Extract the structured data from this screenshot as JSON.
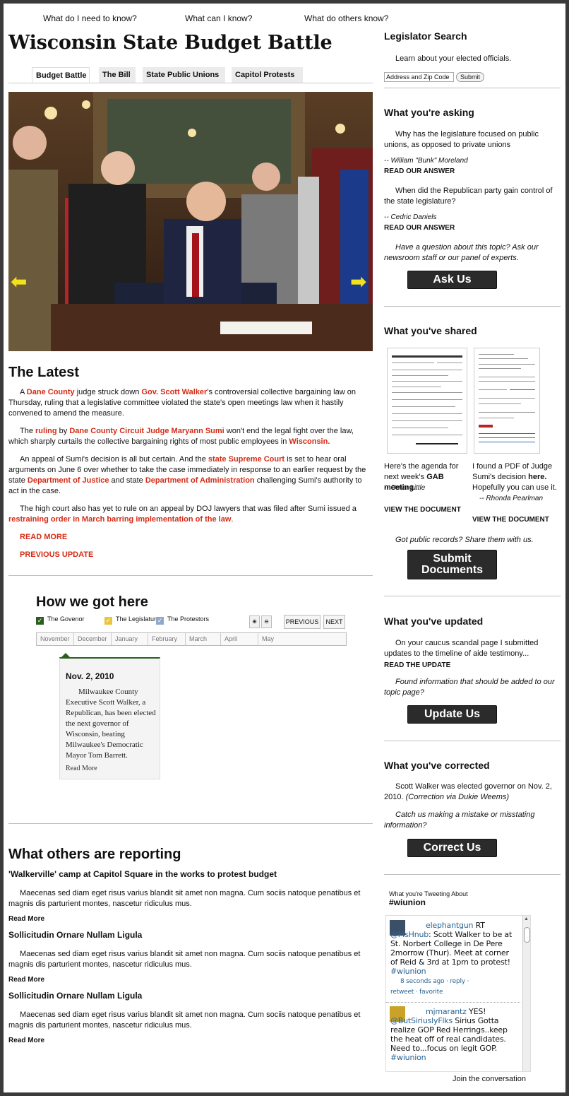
{
  "topnav": [
    "What do I need to know?",
    "What can I know?",
    "What do others know?"
  ],
  "site_title": "Wisconsin State Budget Battle",
  "tabs": [
    "Budget Battle",
    "The Bill",
    "State Public Unions",
    "Capitol Protests"
  ],
  "hero": {
    "prev_arrow": "⬅",
    "next_arrow": "➡"
  },
  "latest": {
    "heading": "The Latest",
    "p1": {
      "t1": "A ",
      "l1": "Dane County",
      "t2": " judge struck down ",
      "l2": "Gov. Scott Walker",
      "t3": "'s controversial collective bargaining law on Thursday, ruling that a legislative committee violated the state's open meetings law when it hastily convened to amend the measure."
    },
    "p2": {
      "t1": "The ",
      "l1": "ruling",
      "t2": " by ",
      "l2": "Dane County Circuit Judge Maryann Sumi",
      "t3": " won't end the legal fight over the law, which sharply curtails the collective bargaining rights of most public employees in ",
      "l3": "Wisconsin."
    },
    "p3": {
      "t1": "An appeal of Sumi's decision is all but certain. And the ",
      "l1": "state Supreme Court",
      "t2": " is set to hear oral arguments on June 6 over whether to take the case immediately in response to an earlier request by the state ",
      "l2": "Department of Justice",
      "t3": " and state ",
      "l3": "Department of Administration",
      "t4": " challenging Sumi's authority to act in the case."
    },
    "p4": {
      "t1": "The high court also has yet to rule on an appeal by DOJ lawyers that was filed after Sumi issued a ",
      "l1": "restraining order in March barring implementation of the law",
      "t2": "."
    },
    "read_more": "READ MORE",
    "previous_update": "PREVIOUS UPDATE"
  },
  "timeline": {
    "heading": "How we got here",
    "legend": [
      {
        "label": "The Govenor",
        "color": "#2a5e1e"
      },
      {
        "label": "The Legislature",
        "color": "#e8c53a"
      },
      {
        "label": "The Protestors",
        "color": "#8fa9c9"
      }
    ],
    "prev_label": "PREVIOUS",
    "next_label": "NEXT",
    "months": [
      "November",
      "December",
      "January",
      "February",
      "March",
      "April",
      "May"
    ],
    "event": {
      "date": "Nov. 2, 2010",
      "text": "Milwaukee County Executive Scott Walker, a Republican, has been elected the next governor of Wisconsin, beating Milwaukee's Democratic Mayor Tom Barrett.",
      "read_more": "Read More"
    }
  },
  "others": {
    "heading": "What others are reporting",
    "items": [
      {
        "title": "'Walkerville' camp at Capitol Square in the works to protest budget",
        "body": "Maecenas sed diam eget risus varius blandit sit amet non magna. Cum sociis natoque penatibus et magnis dis parturient montes, nascetur ridiculus mus.",
        "more": "Read More"
      },
      {
        "title": "Sollicitudin Ornare Nullam Ligula",
        "body": "Maecenas sed diam eget risus varius blandit sit amet non magna. Cum sociis natoque penatibus et magnis dis parturient montes, nascetur ridiculus mus.",
        "more": "Read More"
      },
      {
        "title": "Sollicitudin Ornare Nullam Ligula",
        "body": "Maecenas sed diam eget risus varius blandit sit amet non magna. Cum sociis natoque penatibus et magnis dis parturient montes, nascetur ridiculus mus.",
        "more": "Read More"
      }
    ]
  },
  "sidebar": {
    "legislator": {
      "heading": "Legislator Search",
      "text": "Learn about your elected officials.",
      "placeholder": "Address and Zip Code",
      "submit": "Submit"
    },
    "asking": {
      "heading": "What you're asking",
      "q1": "Why has the legislature focused on public unions, as opposed to private unions",
      "q1_by": "-- William \"Bunk\" Moreland",
      "q2": "When did the Republican party gain control of the state legislature?",
      "q2_by": "-- Cedric Daniels",
      "read_answer": "READ OUR ANSWER",
      "prompt": "Have a question about this topic? Ask our newsroom staff or our panel of experts.",
      "button": "Ask Us"
    },
    "shared": {
      "heading": "What you've shared",
      "d1_text1": "Here's the agenda for next week's ",
      "d1_bold": "GAB meeting.",
      "d1_by": "-- Omar Little",
      "d2_text1": "I found a PDF of Judge Sumi's decision ",
      "d2_bold": "here.",
      "d2_text2": " Hopefully you can use it.",
      "d2_by": "-- Rhonda Pearlman",
      "view": "VIEW THE DOCUMENT",
      "prompt": "Got public records? Share them with us.",
      "button_l1": "Submit",
      "button_l2": "Documents"
    },
    "updated": {
      "heading": "What you've updated",
      "text": "On your caucus scandal page I submitted updates to the timeline of aide testimony...",
      "read_update": "READ THE UPDATE",
      "prompt": "Found information that should be added to our topic page?",
      "button": "Update Us"
    },
    "corrected": {
      "heading": "What you've corrected",
      "text": "Scott Walker was elected governor on Nov. 2, 2010. ",
      "credit": "(Correction via Dukie Weems)",
      "prompt": "Catch us making a mistake or misstating information?",
      "button": "Correct Us"
    },
    "tweets": {
      "label": "What you're Tweeting About",
      "hashtag": "#wiunion",
      "t1": {
        "user": "elephantgun",
        "rt": " RT ",
        "mention": "@MsHnub",
        "text": ": Scott Walker to be at St. Norbert College in De Pere 2morrow (Thur). Meet at corner of Reid & 3rd at 1pm to protest! ",
        "tag": "#wiunion",
        "time": "8 seconds ago",
        "reply": "reply",
        "retweet": "retweet",
        "favorite": "favorite"
      },
      "t2": {
        "user": "mjmarantz",
        "text1": " YES! ",
        "mention": "@ButSiriuslyFlks",
        "text": " Sirius Gotta realize GOP Red Herrings..keep the heat off of real candidates. Need to...focus on legit GOP. ",
        "tag": "#wiunion"
      },
      "join": "Join the conversation"
    }
  }
}
